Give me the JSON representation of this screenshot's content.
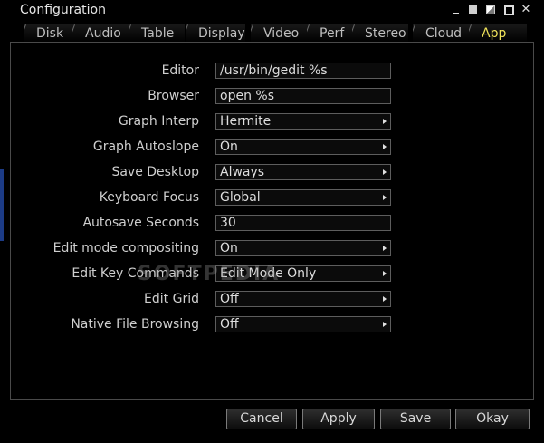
{
  "window": {
    "title": "Configuration"
  },
  "tabs": [
    {
      "label": "Disk"
    },
    {
      "label": "Audio"
    },
    {
      "label": "Table"
    },
    {
      "label": "Display"
    },
    {
      "label": "Video"
    },
    {
      "label": "Perf"
    },
    {
      "label": "Stereo"
    },
    {
      "label": "Cloud"
    },
    {
      "label": "App"
    }
  ],
  "active_tab": "App",
  "settings": {
    "editor": {
      "label": "Editor",
      "value": "/usr/bin/gedit %s"
    },
    "browser": {
      "label": "Browser",
      "value": "open %s"
    },
    "graph_interp": {
      "label": "Graph Interp",
      "value": "Hermite"
    },
    "graph_autoslope": {
      "label": "Graph Autoslope",
      "value": "On"
    },
    "save_desktop": {
      "label": "Save Desktop",
      "value": "Always"
    },
    "keyboard_focus": {
      "label": "Keyboard Focus",
      "value": "Global"
    },
    "autosave_seconds": {
      "label": "Autosave Seconds",
      "value": "30"
    },
    "edit_mode_compositing": {
      "label": "Edit mode compositing",
      "value": "On"
    },
    "edit_key_commands": {
      "label": "Edit Key Commands",
      "value": "Edit Mode Only"
    },
    "edit_grid": {
      "label": "Edit Grid",
      "value": "Off"
    },
    "native_file_browsing": {
      "label": "Native File Browsing",
      "value": "Off"
    }
  },
  "watermark": "SOFTPEDIA",
  "buttons": {
    "cancel": "Cancel",
    "apply": "Apply",
    "save": "Save",
    "okay": "Okay"
  },
  "colors": {
    "active_tab": "#f0e35a",
    "background": "#000000",
    "text": "#cfcfcf"
  }
}
